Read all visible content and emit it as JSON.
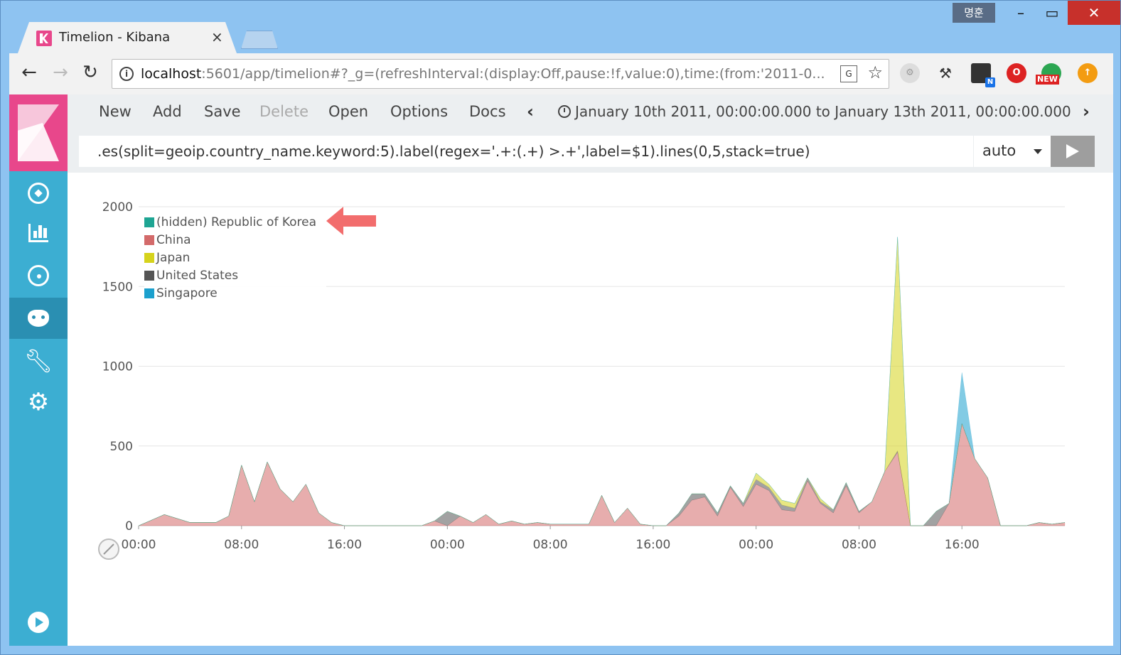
{
  "browser": {
    "tab_title": "Timelion - Kibana",
    "tab_close": "×",
    "ime_label": "명훈",
    "url_host": "localhost",
    "url_rest": ":5601/app/timelion#?_g=(refreshInterval:(display:Off,pause:!f,value:0),time:(from:'2011-0...",
    "ext_new_badge": "NEW",
    "ext_n_badge": "N"
  },
  "menu": {
    "items": [
      "New",
      "Add",
      "Save",
      "Delete",
      "Open",
      "Options",
      "Docs"
    ],
    "disabled": [
      "Delete"
    ],
    "time_range": "January 10th 2011, 00:00:00.000 to January 13th 2011, 00:00:00.000"
  },
  "query": {
    "expression": ".es(split=geoip.country_name.keyword:5).label(regex='.+:(.+) >.+',label=$1).lines(0,5,stack=true)",
    "interval": "auto"
  },
  "legend": [
    {
      "label": "(hidden) Republic of Korea",
      "color": "#1ea593"
    },
    {
      "label": "China",
      "color": "#d36a6a"
    },
    {
      "label": "Japan",
      "color": "#d6d31c"
    },
    {
      "label": "United States",
      "color": "#555555"
    },
    {
      "label": "Singapore",
      "color": "#1ca0cd"
    }
  ],
  "chart_data": {
    "type": "area",
    "stacked": true,
    "ylim": [
      0,
      2000
    ],
    "yticks": [
      0,
      500,
      1000,
      1500,
      2000
    ],
    "xticks": [
      "00:00",
      "08:00",
      "16:00",
      "00:00",
      "08:00",
      "16:00",
      "00:00",
      "08:00",
      "16:00"
    ],
    "x_hours": [
      0,
      2,
      4,
      6,
      7,
      8,
      9,
      10,
      11,
      12,
      13,
      14,
      15,
      16,
      17,
      18,
      19,
      20,
      21,
      22,
      23,
      24,
      25,
      26,
      27,
      28,
      29,
      30,
      31,
      32,
      33,
      34,
      35,
      36,
      37,
      38,
      39,
      40,
      41,
      42,
      43,
      44,
      45,
      46,
      47,
      48,
      49,
      50,
      51,
      52,
      53,
      54,
      55,
      56,
      57,
      58,
      59,
      60,
      61,
      62,
      63,
      64,
      65,
      66,
      67,
      68,
      69,
      70,
      71,
      72
    ],
    "series": [
      {
        "name": "China",
        "values": [
          0,
          70,
          20,
          20,
          60,
          380,
          150,
          400,
          230,
          150,
          260,
          80,
          20,
          0,
          0,
          0,
          0,
          0,
          0,
          0,
          30,
          0,
          60,
          20,
          70,
          10,
          30,
          10,
          20,
          10,
          10,
          10,
          10,
          190,
          20,
          110,
          10,
          0,
          0,
          60,
          160,
          180,
          60,
          240,
          120,
          260,
          220,
          100,
          90,
          280,
          140,
          80,
          250,
          80,
          150,
          340,
          460,
          0,
          0,
          0,
          140,
          640,
          420,
          300,
          0,
          0,
          0,
          20,
          10,
          20
        ]
      },
      {
        "name": "United States",
        "values": [
          0,
          0,
          0,
          0,
          0,
          0,
          0,
          0,
          0,
          0,
          0,
          0,
          0,
          0,
          0,
          0,
          0,
          0,
          0,
          0,
          0,
          90,
          0,
          0,
          0,
          0,
          0,
          0,
          0,
          0,
          0,
          0,
          0,
          0,
          0,
          0,
          0,
          0,
          0,
          20,
          40,
          20,
          20,
          10,
          20,
          30,
          20,
          30,
          20,
          20,
          10,
          20,
          20,
          10,
          0,
          0,
          10,
          0,
          0,
          90,
          0,
          0,
          0,
          0,
          0,
          0,
          0,
          0,
          0,
          0
        ]
      },
      {
        "name": "Japan",
        "values": [
          0,
          0,
          0,
          0,
          0,
          0,
          0,
          0,
          0,
          0,
          0,
          0,
          0,
          0,
          0,
          0,
          0,
          0,
          0,
          0,
          0,
          0,
          0,
          0,
          0,
          0,
          0,
          0,
          0,
          0,
          0,
          0,
          0,
          0,
          0,
          0,
          0,
          0,
          0,
          0,
          0,
          0,
          0,
          0,
          0,
          40,
          20,
          30,
          30,
          0,
          20,
          0,
          0,
          0,
          0,
          0,
          1340,
          0,
          0,
          0,
          0,
          0,
          0,
          0,
          0,
          0,
          0,
          0,
          0,
          0
        ]
      },
      {
        "name": "Singapore",
        "values": [
          0,
          0,
          0,
          0,
          0,
          0,
          0,
          0,
          0,
          0,
          0,
          0,
          0,
          0,
          0,
          0,
          0,
          0,
          0,
          0,
          0,
          0,
          0,
          0,
          0,
          0,
          0,
          0,
          0,
          0,
          0,
          0,
          0,
          0,
          0,
          0,
          0,
          0,
          0,
          0,
          0,
          0,
          0,
          0,
          0,
          0,
          0,
          0,
          0,
          0,
          0,
          0,
          0,
          0,
          0,
          0,
          0,
          0,
          0,
          0,
          0,
          320,
          0,
          0,
          0,
          0,
          0,
          0,
          0,
          0
        ]
      }
    ]
  }
}
